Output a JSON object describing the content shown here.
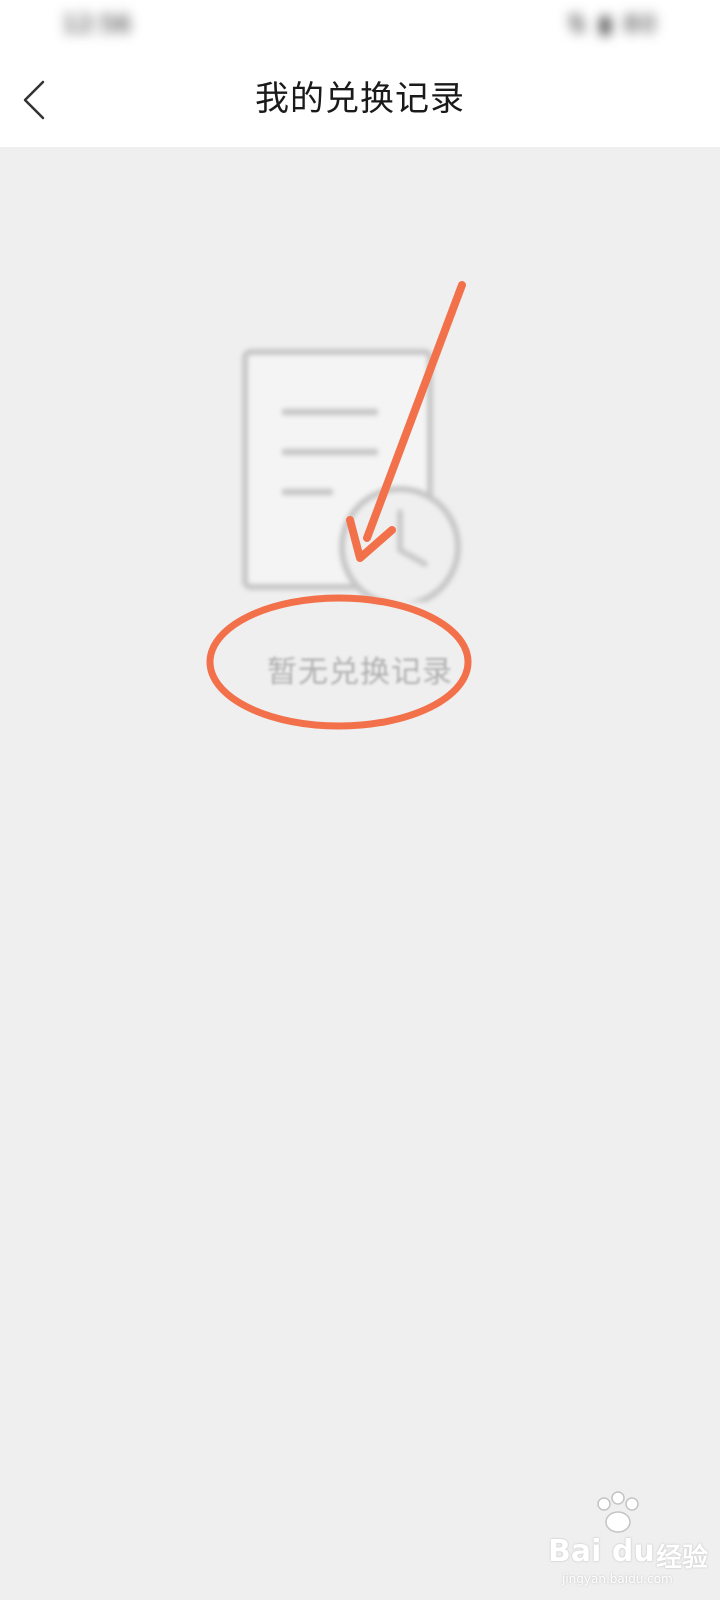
{
  "status_bar": {
    "time": "12:56",
    "icons": "⇅ ▮ 80"
  },
  "header": {
    "title": "我的兑换记录"
  },
  "empty_state": {
    "message": "暂无兑换记录"
  },
  "annotation": {
    "color": "#f2714a"
  },
  "watermark": {
    "brand": "Bai du",
    "suffix": "经验",
    "url": "jingyan.baidu.com"
  }
}
